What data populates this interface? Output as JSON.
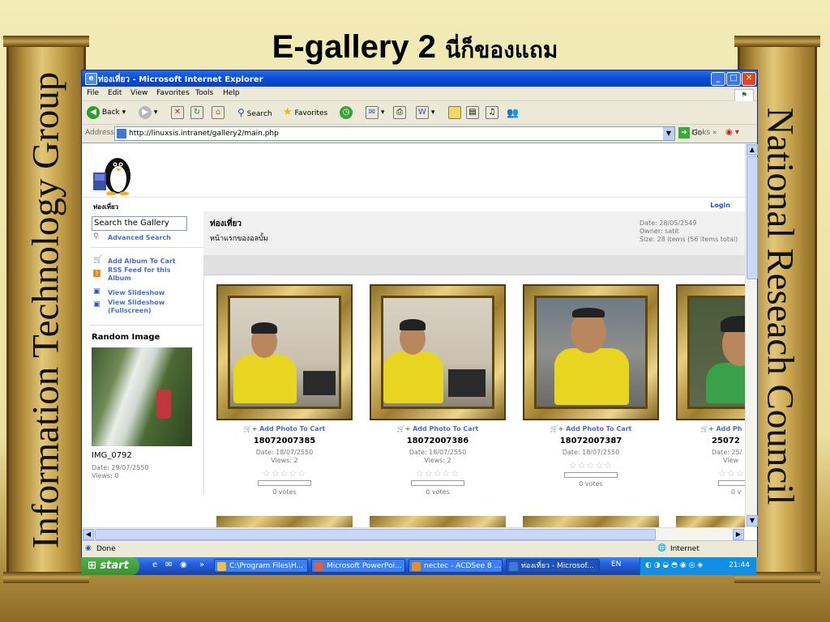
{
  "slide": {
    "title_main": "E-gallery 2",
    "title_thai": "นี่ก็ของแถม",
    "left_pillar_text": "Information Technology Group",
    "right_pillar_text": "National Reseach Council"
  },
  "window": {
    "title": "ท่องเที่ยว - Microsoft Internet Explorer",
    "minimize": "_",
    "maximize": "□",
    "close": "✕"
  },
  "menu": [
    "File",
    "Edit",
    "View",
    "Favorites",
    "Tools",
    "Help"
  ],
  "toolbar": {
    "back": "Back",
    "search": "Search",
    "favorites": "Favorites"
  },
  "address": {
    "label": "Address",
    "url": "http://linuxsis.intranet/gallery2/main.php",
    "go": "Go",
    "links": "Links"
  },
  "page": {
    "site_name": "ท่องเที่ยว",
    "login": "Login",
    "sidebar": {
      "search_placeholder": "Search the Gallery",
      "advanced_search": "Advanced Search",
      "add_album_to_cart": "Add Album To Cart",
      "rss_feed": "RSS Feed for this Album",
      "view_slideshow": "View Slideshow",
      "view_slideshow_full": "View Slideshow (Fullscreen)",
      "random_heading": "Random Image",
      "random_name": "IMG_0792",
      "random_date": "Date: 29/07/2550",
      "random_views": "Views: 0"
    },
    "album": {
      "title": "ท่องเที่ยว",
      "description": "หน้าแรกของอลบั้ม",
      "date": "Date: 28/05/2549",
      "owner": "Owner: satit",
      "size": "Size: 28 items (56 items total)"
    },
    "items": [
      {
        "add": "Add Photo To Cart",
        "name": "18072007385",
        "date": "Date: 18/07/2550",
        "views": "Views: 2",
        "votes": "0 votes"
      },
      {
        "add": "Add Photo To Cart",
        "name": "18072007386",
        "date": "Date: 18/07/2550",
        "views": "Views: 2",
        "votes": "0 votes"
      },
      {
        "add": "Add Photo To Cart",
        "name": "18072007387",
        "date": "Date: 18/07/2550",
        "views": "",
        "votes": "0 votes"
      },
      {
        "add": "Add Ph",
        "name": "25072",
        "date": "Date: 25/",
        "views": "View",
        "votes": "0 v"
      }
    ]
  },
  "status": {
    "text": "Done",
    "zone": "Internet"
  },
  "taskbar": {
    "start": "start",
    "tasks": [
      "C:\\Program Files\\H...",
      "Microsoft PowerPoi...",
      "nectec - ACDSee 8 ...",
      "ท่องเที่ยว - Microsof..."
    ],
    "lang": "EN",
    "clock": "21:44"
  }
}
